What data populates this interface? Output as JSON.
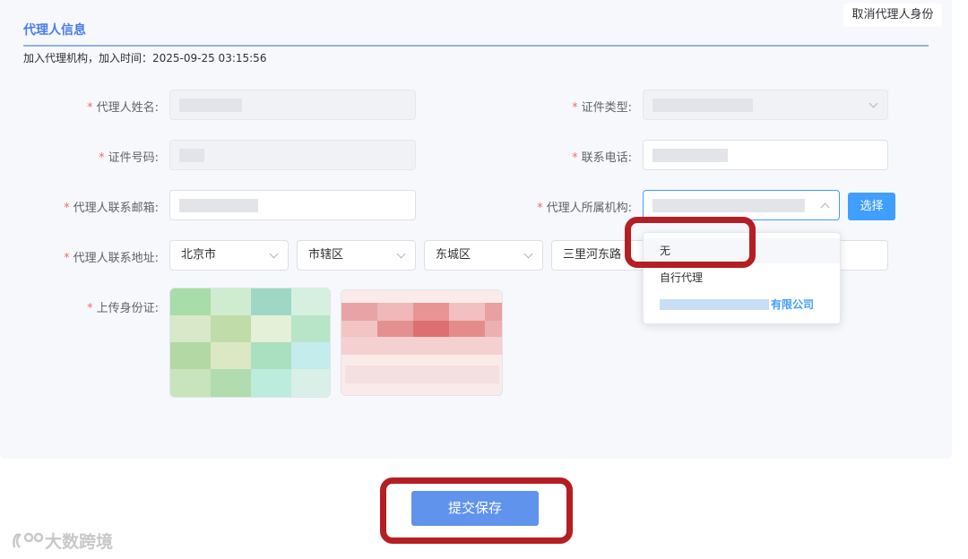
{
  "header": {
    "title": "代理人信息",
    "cancel_label": "取消代理人身份",
    "join_info": "加入代理机构，加入时间：2025-09-25 03:15:56"
  },
  "form": {
    "name_label": "代理人姓名:",
    "id_type_label": "证件类型:",
    "id_number_label": "证件号码:",
    "phone_label": "联系电话:",
    "email_label": "代理人联系邮箱:",
    "org_label": "代理人所属机构:",
    "address_label": "代理人联系地址:",
    "upload_label": "上传身份证:",
    "required_mark": "*",
    "address": {
      "province": "北京市",
      "city": "市辖区",
      "district": "东城区",
      "street": "三里河东路"
    },
    "select_button": "选择"
  },
  "org_dropdown": {
    "options": [
      "无",
      "自行代理"
    ],
    "company_suffix": "有限公司"
  },
  "footer": {
    "submit_label": "提交保存"
  },
  "watermark": {
    "text": "大数跨境"
  },
  "colors": {
    "accent": "#409eff",
    "title": "#4b7bec",
    "submit": "#5f93ec",
    "required": "#f56c6c",
    "highlight": "#b51e23"
  }
}
